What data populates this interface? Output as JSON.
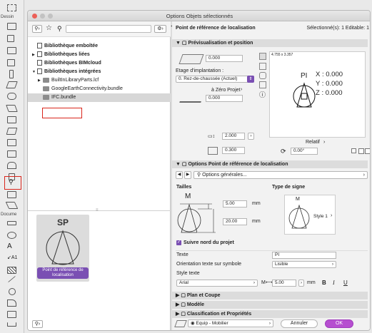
{
  "toolbox": {
    "label_dessin": "Dessin",
    "label_docume": "Docume"
  },
  "window": {
    "title": "Options Objets sélectionnés"
  },
  "left": {
    "search_placeholder": "",
    "tree": [
      {
        "label": "Bibliothèque emboîtée",
        "indent": 0,
        "icon": "doc"
      },
      {
        "label": "Bibliothèques liées",
        "indent": 0,
        "icon": "doc",
        "arrow": "▶"
      },
      {
        "label": "Bibliothèques BIMcloud",
        "indent": 0,
        "icon": "doc"
      },
      {
        "label": "Bibliothèques intégrées",
        "indent": 0,
        "icon": "doc",
        "arrow": "▼"
      },
      {
        "label": "BuiltInLibraryParts.lcf",
        "indent": 1,
        "icon": "folder",
        "arrow": "▶"
      },
      {
        "label": "GoogleEarthConnectivity.bundle",
        "indent": 1,
        "icon": "folder"
      },
      {
        "label": "IFC.bundle",
        "indent": 1,
        "icon": "folder",
        "selected": true
      }
    ],
    "preview": {
      "letters": "SP",
      "caption": "Point de référence de localisation"
    }
  },
  "right": {
    "object_name": "Point de référence de localisation",
    "selected_count": "Sélectionné(s): 1 Editable: 1",
    "sec_preview": "Prévisualisation et position",
    "elev_value": "0.000",
    "story_label": "Etage d'implantation :",
    "story_value": "0. Rez-de-chaussée (Actuel)",
    "zero_label": "à Zéro Projet",
    "zero_value": "0.000",
    "dim_small": "4.755 x 3.357",
    "pi_label": "PI",
    "x_text": "X : 0.000",
    "y_text": "Y : 0.000",
    "z_text": "Z : 0.000",
    "width_value": "2.000",
    "height_value": "0.300",
    "relatif_label": "Relatif",
    "angle_value": "0.00°",
    "sec_options": "Options Point de référence de localisation",
    "options_general": "Options générales...",
    "tailles": "Tailles",
    "type_signe": "Type de signe",
    "m_label": "M",
    "m_label2": "M",
    "size1": "5.00",
    "size2": "20.00",
    "unit_mm": "mm",
    "unit_mm2": "mm",
    "style1": "Style 1",
    "suivre_nord": "Suivre nord du projet",
    "texte_label": "Texte",
    "texte_value": "PI",
    "orient_label": "Orientation texte sur symbole",
    "orient_value": "Lisible",
    "style_texte_label": "Style texte",
    "font_value": "Arial",
    "font_size": "5.00",
    "font_unit": "mm",
    "fmt_b": "B",
    "fmt_i": "I",
    "fmt_u": "U",
    "sec_plan": "Plan et Coupe",
    "sec_modele": "Modèle",
    "sec_class": "Classification et Propriétés",
    "layer_value": "Equip - Mobilier",
    "cancel": "Annuler",
    "ok": "OK"
  }
}
